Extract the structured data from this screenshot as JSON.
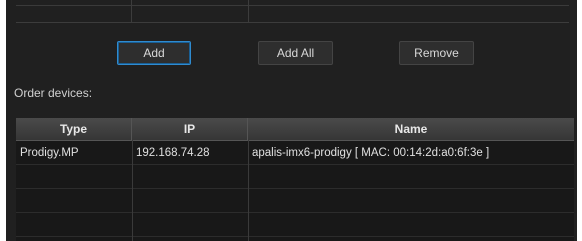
{
  "buttons": {
    "add": "Add",
    "add_all": "Add All",
    "remove": "Remove"
  },
  "order_devices_label": "Order devices:",
  "table": {
    "headers": [
      "Type",
      "IP",
      "Name"
    ],
    "rows": [
      [
        "Prodigy.MP",
        "192.168.74.28",
        "apalis-imx6-prodigy [ MAC: 00:14:2d:a0:6f:3e ]"
      ],
      [
        "",
        "",
        ""
      ],
      [
        "",
        "",
        ""
      ],
      [
        "",
        "",
        ""
      ]
    ]
  }
}
